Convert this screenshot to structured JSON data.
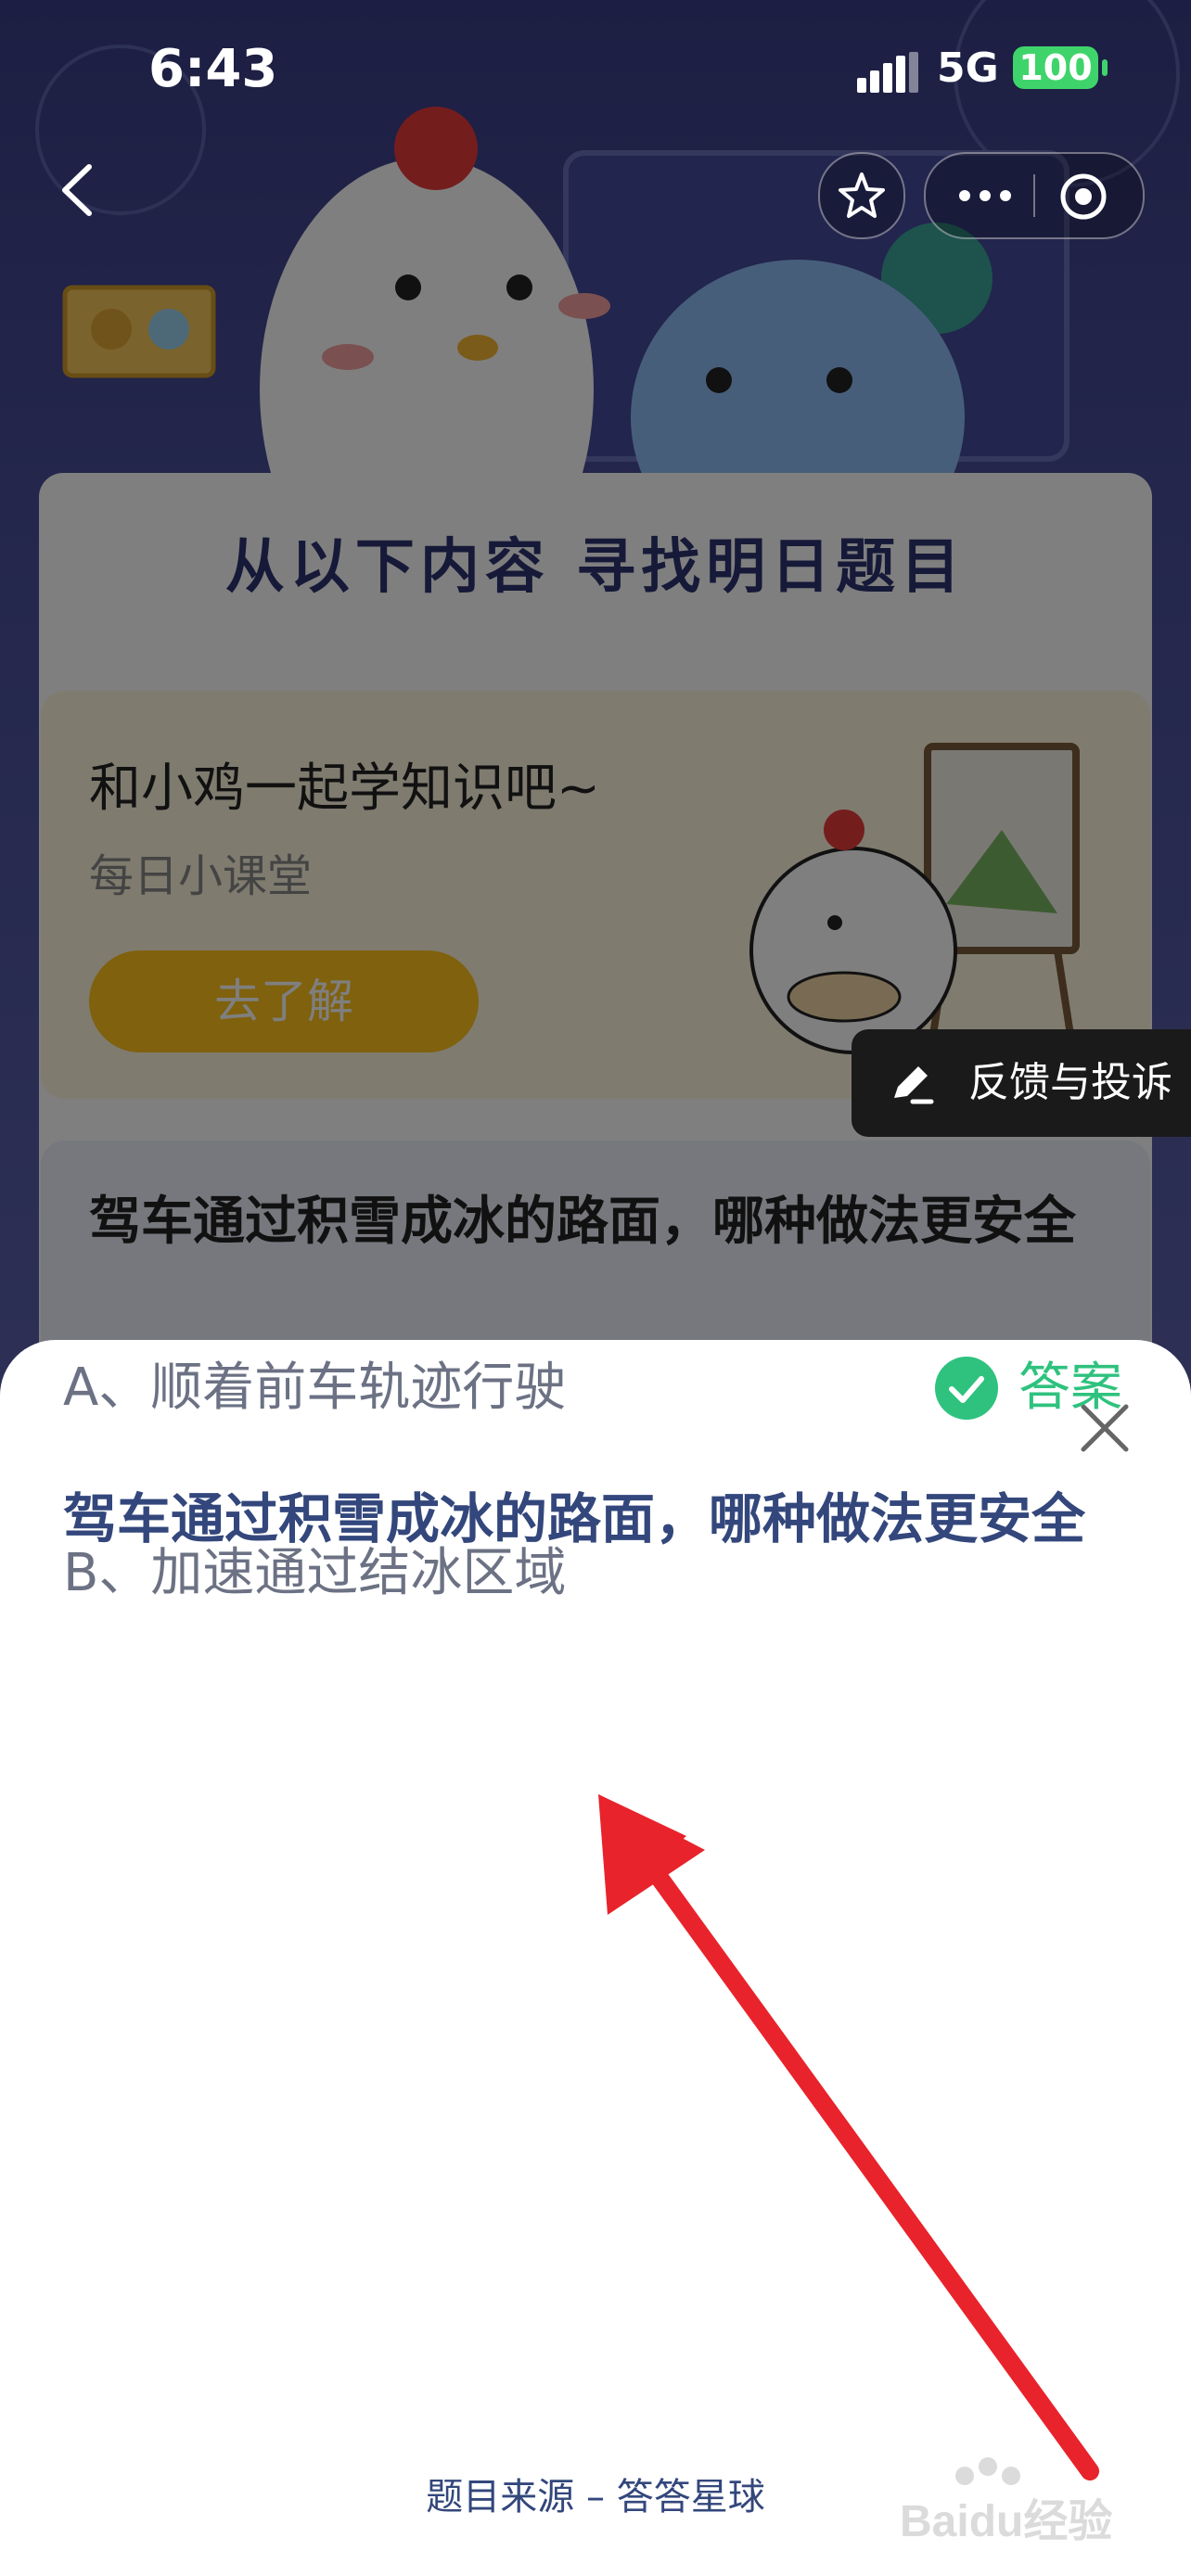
{
  "status_bar": {
    "time": "6:43",
    "network": "5G",
    "battery": "100"
  },
  "background_page": {
    "find_title": "从以下内容  寻找明日题目",
    "lesson_card": {
      "title": "和小鸡一起学知识吧~",
      "subtitle": "每日小课堂",
      "button_label": "去了解"
    },
    "question_card_text": "驾车通过积雪成冰的路面，哪种做法更安全"
  },
  "feedback": {
    "label": "反馈与投诉"
  },
  "answer_sheet": {
    "question": "驾车通过积雪成冰的路面，哪种做法更安全",
    "options": [
      {
        "text": "A、顺着前车轨迹行驶",
        "is_answer": true
      },
      {
        "text": "B、加速通过结冰区域",
        "is_answer": false
      }
    ],
    "answer_label": "答案",
    "source": "题目来源 – 答答星球"
  },
  "watermark": {
    "text": "Baidu经验"
  },
  "colors": {
    "question_text": "#33477c",
    "option_text": "#6c7284",
    "answer_green": "#2ec27e",
    "arrow_red": "#e8232b",
    "lesson_button": "#ffc21c",
    "battery_green": "#3fd46b"
  },
  "icons": {
    "back": "chevron-left-icon",
    "star": "star-icon",
    "more": "more-dots-icon",
    "record": "record-target-icon",
    "feedback": "pencil-edit-icon",
    "close": "close-icon",
    "answer": "check-circle-icon"
  }
}
